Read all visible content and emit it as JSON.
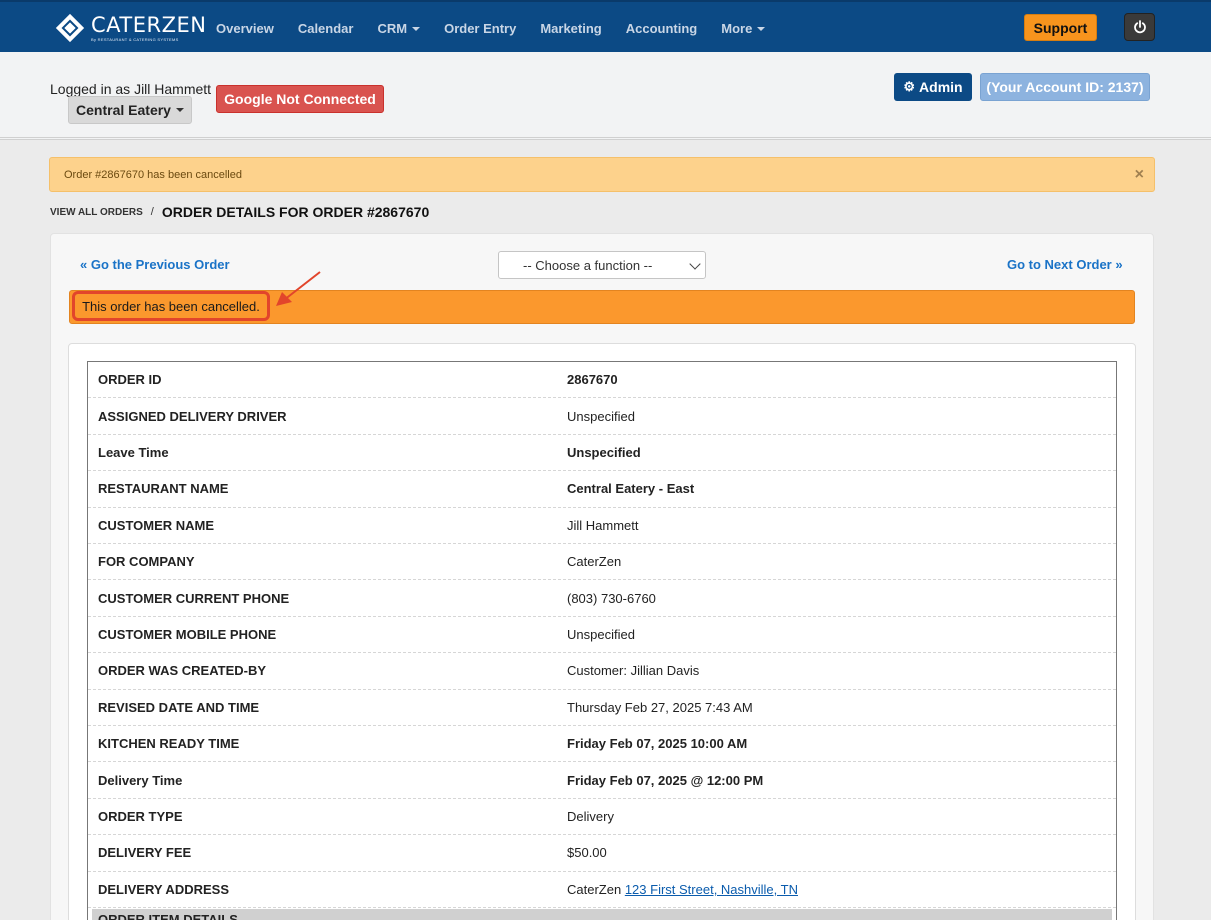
{
  "app": {
    "logo_name": "CATERZEN",
    "logo_sub": "By RESTAURANT & CATERING SYSTEMS"
  },
  "nav": {
    "items": [
      {
        "label": "Overview",
        "has_caret": false
      },
      {
        "label": "Calendar",
        "has_caret": false
      },
      {
        "label": "CRM",
        "has_caret": true
      },
      {
        "label": "Order Entry",
        "has_caret": false
      },
      {
        "label": "Marketing",
        "has_caret": false
      },
      {
        "label": "Accounting",
        "has_caret": false
      },
      {
        "label": "More",
        "has_caret": true
      }
    ],
    "support_label": "Support",
    "power_icon": "power-icon"
  },
  "header": {
    "logged_in_text": "Logged in as Jill Hammett",
    "location_label": "Central Eatery",
    "google_label": "Google Not Connected",
    "admin_label": "Admin",
    "account_label": "(Your Account ID: 2137)"
  },
  "alert": {
    "text": "Order #2867670 has been cancelled",
    "close": "×"
  },
  "breadcrumb": {
    "link": "VIEW ALL ORDERS",
    "separator": "/",
    "current": "ORDER DETAILS FOR ORDER #2867670"
  },
  "order_nav": {
    "prev": "« Go the Previous Order",
    "next": "Go to Next Order »",
    "function_select": "-- Choose a function --"
  },
  "cancel_banner": "This order has been cancelled.",
  "details": [
    {
      "label": "ORDER ID",
      "value": "2867670",
      "bold": true
    },
    {
      "label": "ASSIGNED DELIVERY DRIVER",
      "value": "Unspecified",
      "bold": false
    },
    {
      "label": "Leave Time",
      "value": "Unspecified",
      "bold": true
    },
    {
      "label": "RESTAURANT NAME",
      "value": "Central Eatery - East",
      "bold": true
    },
    {
      "label": "CUSTOMER NAME",
      "value": "Jill Hammett",
      "bold": false
    },
    {
      "label": "FOR COMPANY",
      "value": "CaterZen",
      "bold": false
    },
    {
      "label": "CUSTOMER CURRENT PHONE",
      "value": "(803) 730-6760",
      "bold": false
    },
    {
      "label": "CUSTOMER MOBILE PHONE",
      "value": "Unspecified",
      "bold": false
    },
    {
      "label": "ORDER WAS CREATED-BY",
      "value": "Customer: Jillian Davis",
      "bold": false
    },
    {
      "label": "REVISED DATE AND TIME",
      "value": "Thursday Feb 27, 2025 7:43 AM",
      "bold": false
    },
    {
      "label": "KITCHEN READY TIME",
      "value": "Friday Feb 07, 2025 10:00 AM",
      "bold": true
    },
    {
      "label": "Delivery Time",
      "value": "Friday Feb 07, 2025 @ 12:00 PM",
      "bold": true
    },
    {
      "label": "ORDER TYPE",
      "value": "Delivery",
      "bold": false
    },
    {
      "label": "DELIVERY FEE",
      "value": "$50.00",
      "bold": false
    }
  ],
  "delivery_address": {
    "label": "DELIVERY ADDRESS",
    "company": "CaterZen",
    "address_link": "123 First Street, Nashville, TN"
  },
  "items_section": "ORDER ITEM DETAILS",
  "colors": {
    "nav_bg": "#0c4a85",
    "support": "#f7941d",
    "google": "#d9534f",
    "cancel_bar": "#fb982d",
    "highlight": "#e2452b",
    "link": "#1a73c7"
  }
}
